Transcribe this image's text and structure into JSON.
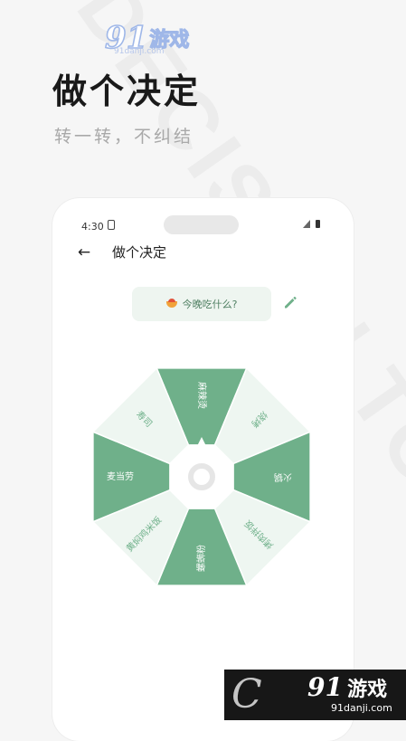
{
  "background_text": "DECISION TOOL",
  "brand": {
    "logo_number": "91",
    "logo_name": "游戏",
    "logo_url": "91danji.com"
  },
  "promo": {
    "headline": "做个决定",
    "subheadline": "转一转，不纠结"
  },
  "status_bar": {
    "time": "4:30"
  },
  "app_bar": {
    "back_icon": "arrow-left-icon",
    "title": "做个决定"
  },
  "question": {
    "icon": "bowl-icon",
    "text": "今晚吃什么?",
    "edit_icon": "pencil-icon"
  },
  "wheel": {
    "dark_color": "#6fb08a",
    "light_color": "#eef6f1",
    "options": [
      "麻辣烫",
      "烧烤",
      "火锅",
      "烤肉拌饭",
      "螺蛳粉",
      "黄焖鸡米饭",
      "麦当劳",
      "寿司"
    ]
  },
  "bottom_watermark": {
    "letter": "C",
    "logo_number": "91",
    "logo_name": "游戏",
    "url": "91danji.com"
  }
}
